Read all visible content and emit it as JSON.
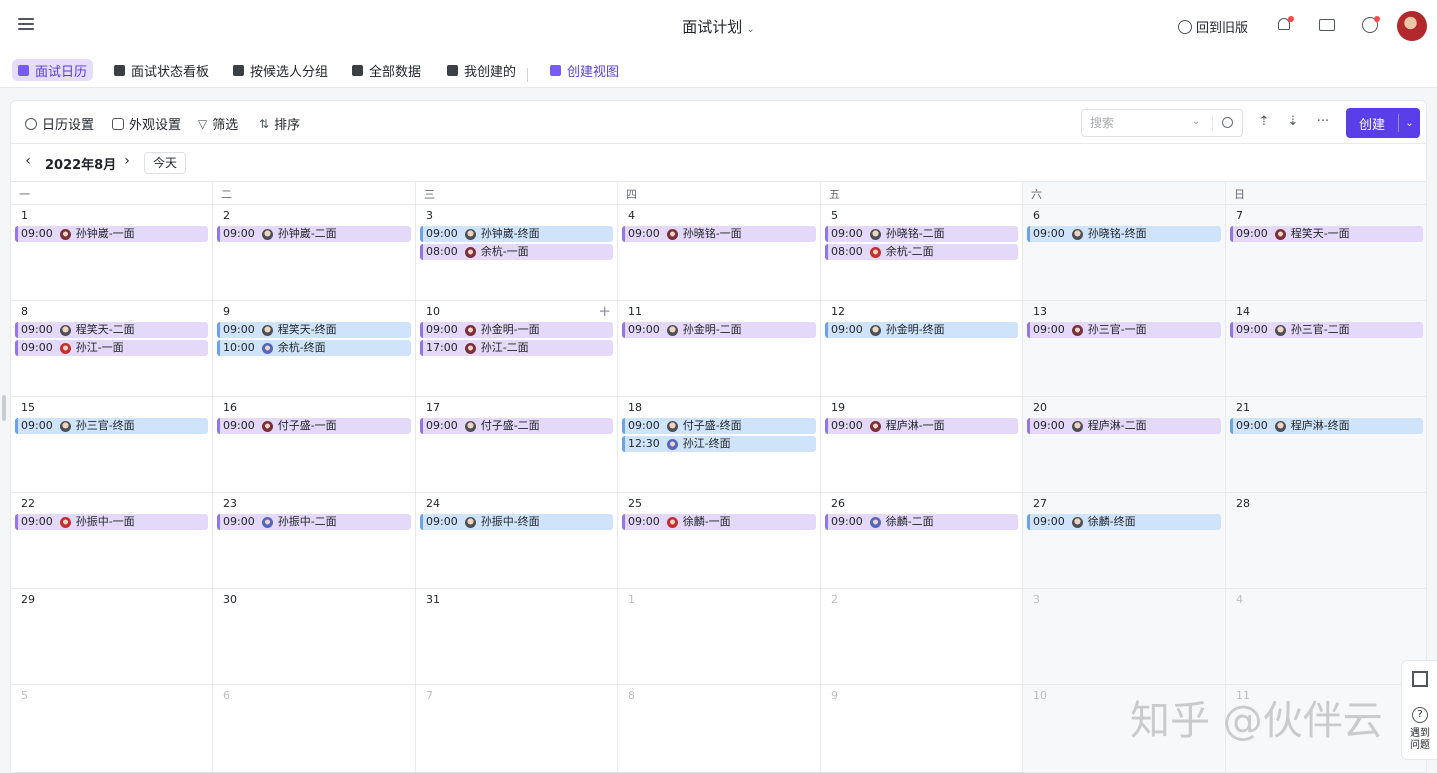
{
  "header": {
    "title": "面试计划",
    "old_version": "回到旧版"
  },
  "tabs": [
    {
      "label": "面试日历",
      "active": true
    },
    {
      "label": "面试状态看板"
    },
    {
      "label": "按候选人分组"
    },
    {
      "label": "全部数据"
    },
    {
      "label": "我创建的"
    },
    {
      "label": "创建视图",
      "accent": true
    }
  ],
  "toolbar": {
    "calendar_settings": "日历设置",
    "appearance": "外观设置",
    "filter": "筛选",
    "sort": "排序",
    "search_placeholder": "搜索",
    "more": "···",
    "create": "创建"
  },
  "calendar": {
    "month_label": "2022年8月",
    "today": "今天",
    "weekdays": [
      "一",
      "二",
      "三",
      "四",
      "五",
      "六",
      "日"
    ],
    "weeks": [
      [
        {
          "day": "1",
          "events": [
            {
              "time": "09:00",
              "title": "孙钟崴-一面",
              "color": "purple",
              "avatar": "f"
            }
          ]
        },
        {
          "day": "2",
          "events": [
            {
              "time": "09:00",
              "title": "孙钟崴-二面",
              "color": "purple",
              "avatar": "m"
            }
          ]
        },
        {
          "day": "3",
          "events": [
            {
              "time": "09:00",
              "title": "孙钟崴-终面",
              "color": "blue",
              "avatar": "m"
            },
            {
              "time": "08:00",
              "title": "余杭-一面",
              "color": "purple",
              "avatar": "f"
            }
          ]
        },
        {
          "day": "4",
          "events": [
            {
              "time": "09:00",
              "title": "孙晓铭-一面",
              "color": "purple",
              "avatar": "f"
            }
          ]
        },
        {
          "day": "5",
          "events": [
            {
              "time": "09:00",
              "title": "孙晓铭-二面",
              "color": "purple",
              "avatar": "m"
            },
            {
              "time": "08:00",
              "title": "余杭-二面",
              "color": "purple",
              "avatar": "r"
            }
          ]
        },
        {
          "day": "6",
          "events": [
            {
              "time": "09:00",
              "title": "孙晓铭-终面",
              "color": "blue",
              "avatar": "m"
            }
          ]
        },
        {
          "day": "7",
          "events": [
            {
              "time": "09:00",
              "title": "程笑天-一面",
              "color": "purple",
              "avatar": "f"
            }
          ]
        }
      ],
      [
        {
          "day": "8",
          "events": [
            {
              "time": "09:00",
              "title": "程笑天-二面",
              "color": "purple",
              "avatar": "m"
            },
            {
              "time": "09:00",
              "title": "孙江-一面",
              "color": "purple",
              "avatar": "r"
            }
          ]
        },
        {
          "day": "9",
          "events": [
            {
              "time": "09:00",
              "title": "程笑天-终面",
              "color": "blue",
              "avatar": "m"
            },
            {
              "time": "10:00",
              "title": "余杭-终面",
              "color": "blue",
              "avatar": "b"
            }
          ]
        },
        {
          "day": "10",
          "plus": true,
          "events": [
            {
              "time": "09:00",
              "title": "孙金明-一面",
              "color": "purple",
              "avatar": "f"
            },
            {
              "time": "17:00",
              "title": "孙江-二面",
              "color": "purple",
              "avatar": "f"
            }
          ]
        },
        {
          "day": "11",
          "events": [
            {
              "time": "09:00",
              "title": "孙金明-二面",
              "color": "purple",
              "avatar": "m"
            }
          ]
        },
        {
          "day": "12",
          "events": [
            {
              "time": "09:00",
              "title": "孙金明-终面",
              "color": "blue",
              "avatar": "m"
            }
          ]
        },
        {
          "day": "13",
          "events": [
            {
              "time": "09:00",
              "title": "孙三官-一面",
              "color": "purple",
              "avatar": "f"
            }
          ]
        },
        {
          "day": "14",
          "events": [
            {
              "time": "09:00",
              "title": "孙三官-二面",
              "color": "purple",
              "avatar": "m"
            }
          ]
        }
      ],
      [
        {
          "day": "15",
          "events": [
            {
              "time": "09:00",
              "title": "孙三官-终面",
              "color": "blue",
              "avatar": "m"
            }
          ]
        },
        {
          "day": "16",
          "events": [
            {
              "time": "09:00",
              "title": "付子盛-一面",
              "color": "purple",
              "avatar": "f"
            }
          ]
        },
        {
          "day": "17",
          "events": [
            {
              "time": "09:00",
              "title": "付子盛-二面",
              "color": "purple",
              "avatar": "m"
            }
          ]
        },
        {
          "day": "18",
          "events": [
            {
              "time": "09:00",
              "title": "付子盛-终面",
              "color": "blue",
              "avatar": "m"
            },
            {
              "time": "12:30",
              "title": "孙江-终面",
              "color": "blue",
              "avatar": "b"
            }
          ]
        },
        {
          "day": "19",
          "events": [
            {
              "time": "09:00",
              "title": "程庐淋-一面",
              "color": "purple",
              "avatar": "f"
            }
          ]
        },
        {
          "day": "20",
          "events": [
            {
              "time": "09:00",
              "title": "程庐淋-二面",
              "color": "purple",
              "avatar": "m"
            }
          ]
        },
        {
          "day": "21",
          "events": [
            {
              "time": "09:00",
              "title": "程庐淋-终面",
              "color": "blue",
              "avatar": "m"
            }
          ]
        }
      ],
      [
        {
          "day": "22",
          "events": [
            {
              "time": "09:00",
              "title": "孙振中-一面",
              "color": "purple",
              "avatar": "r"
            }
          ]
        },
        {
          "day": "23",
          "events": [
            {
              "time": "09:00",
              "title": "孙振中-二面",
              "color": "purple",
              "avatar": "b"
            }
          ]
        },
        {
          "day": "24",
          "events": [
            {
              "time": "09:00",
              "title": "孙振中-终面",
              "color": "blue",
              "avatar": "m"
            }
          ]
        },
        {
          "day": "25",
          "events": [
            {
              "time": "09:00",
              "title": "徐麟-一面",
              "color": "purple",
              "avatar": "r"
            }
          ]
        },
        {
          "day": "26",
          "events": [
            {
              "time": "09:00",
              "title": "徐麟-二面",
              "color": "purple",
              "avatar": "b"
            }
          ]
        },
        {
          "day": "27",
          "events": [
            {
              "time": "09:00",
              "title": "徐麟-终面",
              "color": "blue",
              "avatar": "m"
            }
          ]
        },
        {
          "day": "28",
          "events": []
        }
      ],
      [
        {
          "day": "29",
          "events": []
        },
        {
          "day": "30",
          "events": []
        },
        {
          "day": "31",
          "events": []
        },
        {
          "day": "1",
          "dim": true,
          "events": []
        },
        {
          "day": "2",
          "dim": true,
          "events": []
        },
        {
          "day": "3",
          "dim": true,
          "events": []
        },
        {
          "day": "4",
          "dim": true,
          "events": []
        }
      ],
      [
        {
          "day": "5",
          "dim": true,
          "events": []
        },
        {
          "day": "6",
          "dim": true,
          "events": []
        },
        {
          "day": "7",
          "dim": true,
          "events": []
        },
        {
          "day": "8",
          "dim": true,
          "events": []
        },
        {
          "day": "9",
          "dim": true,
          "events": []
        },
        {
          "day": "10",
          "dim": true,
          "events": []
        },
        {
          "day": "11",
          "dim": true,
          "events": []
        }
      ]
    ]
  },
  "watermark": "知乎 @伙伴云",
  "side_panel": {
    "help_label": "遇到问题"
  },
  "colors": {
    "accent": "#5a3fe8",
    "event_purple": "#e4d9f8",
    "event_blue": "#cfe4fb"
  }
}
